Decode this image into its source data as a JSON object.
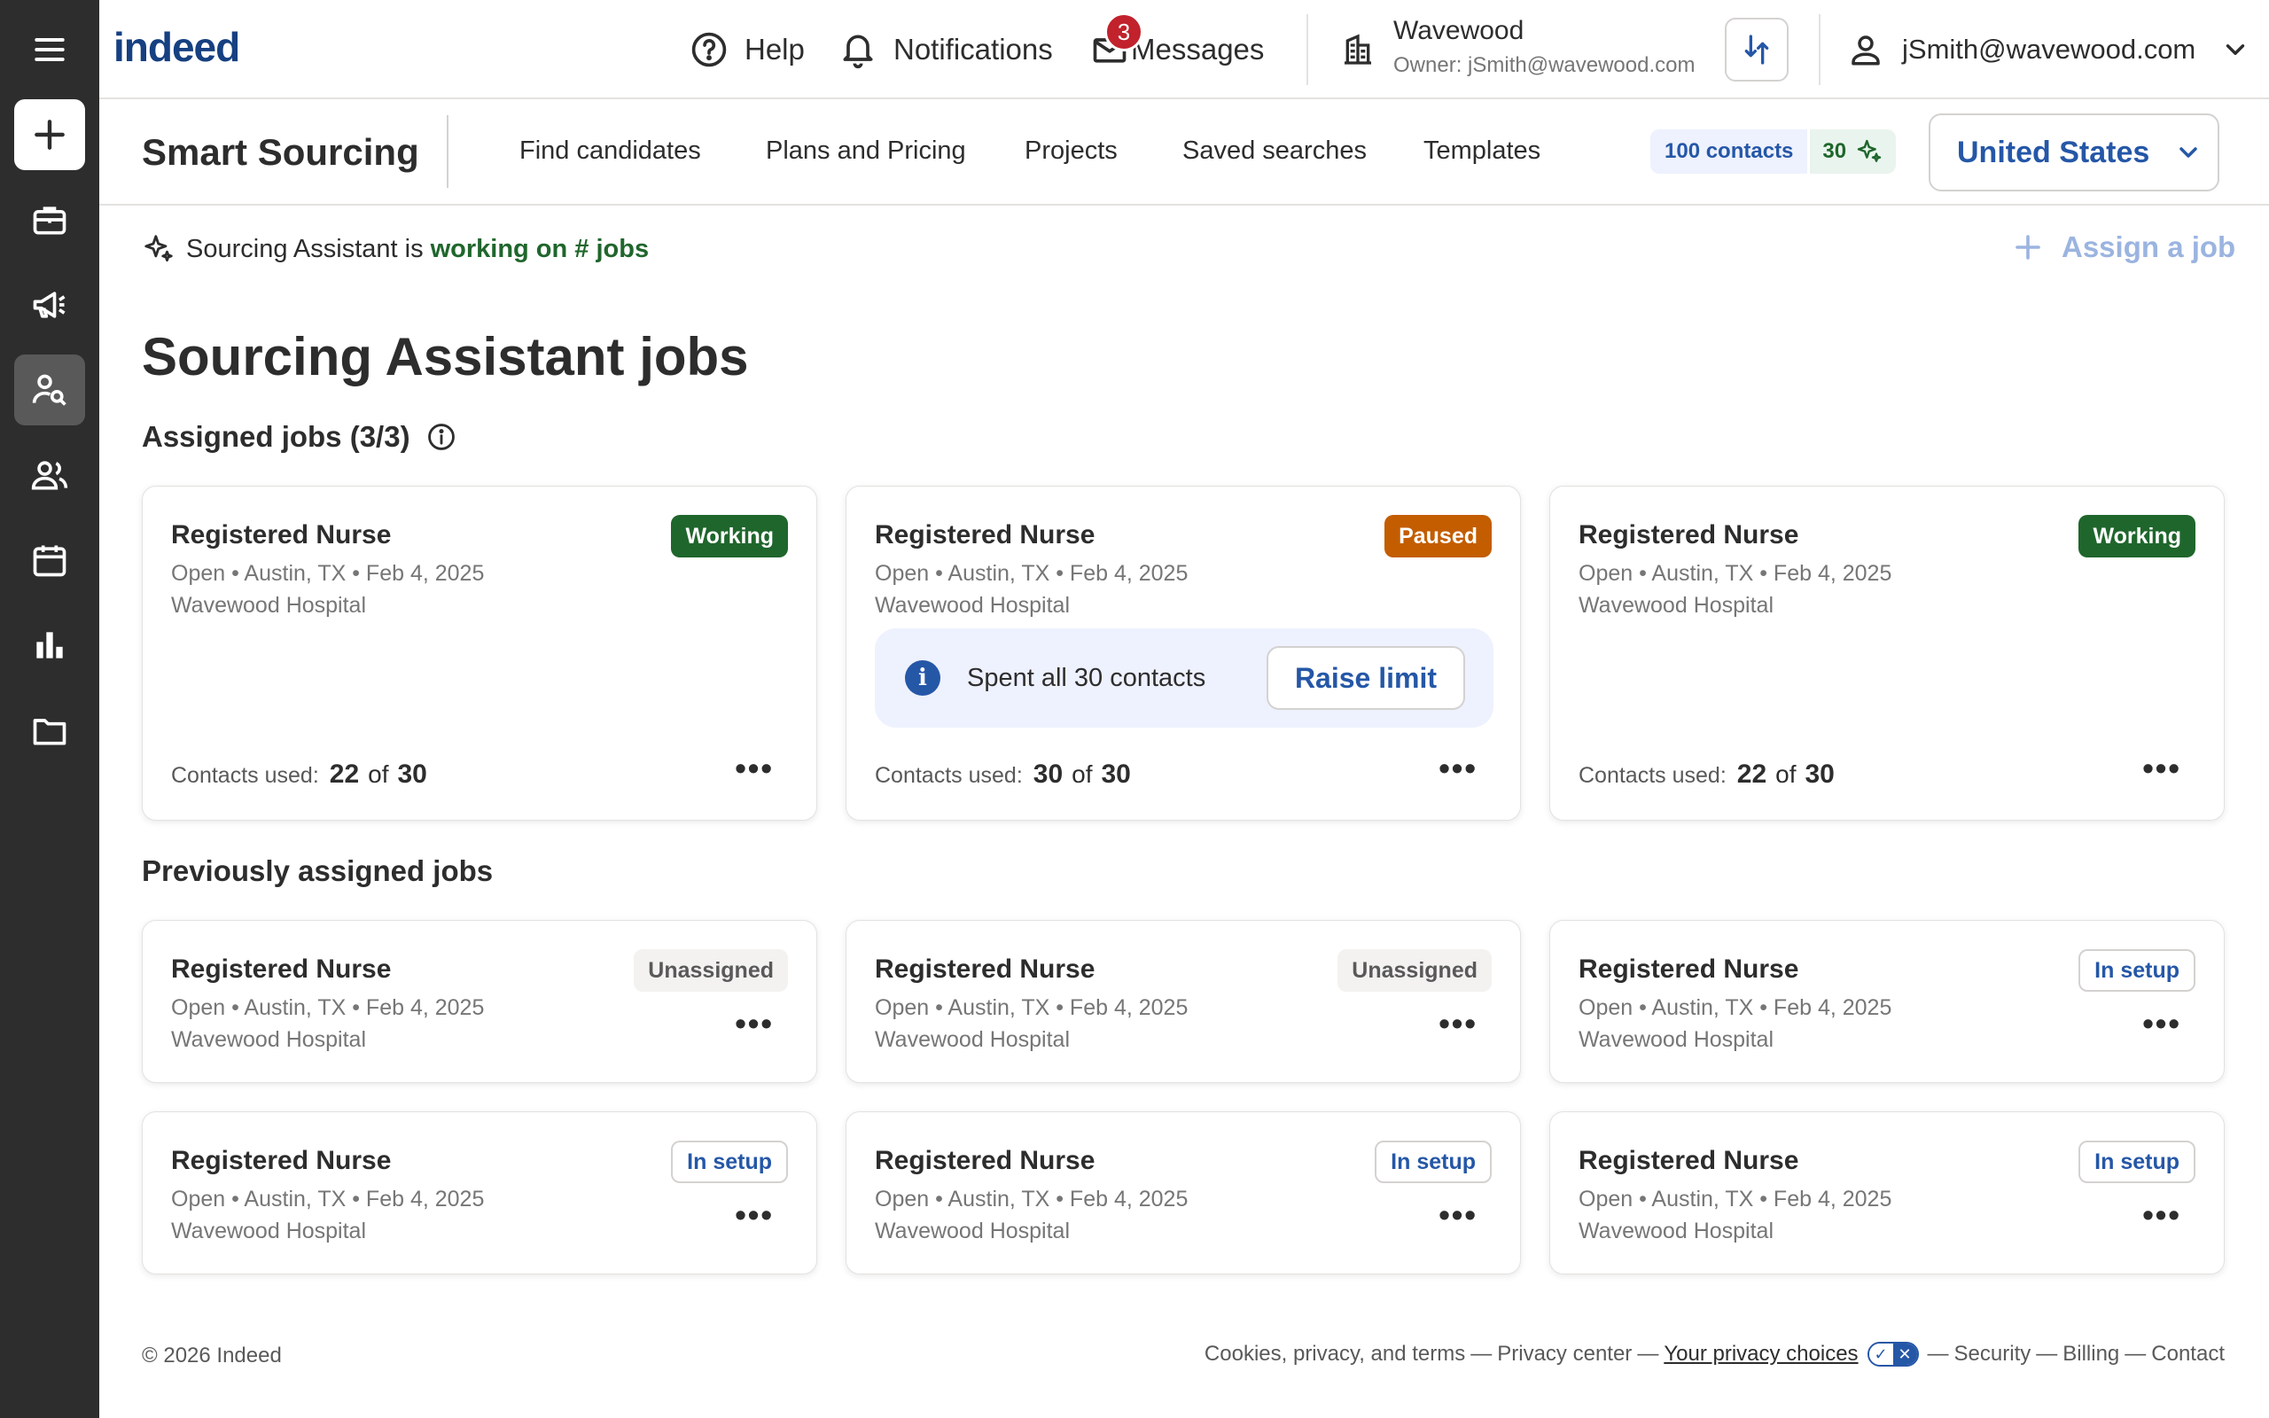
{
  "header": {
    "logo": "indeed",
    "help": "Help",
    "notifications": "Notifications",
    "messages": "Messages",
    "messages_count": "3",
    "company_name": "Wavewood",
    "company_owner": "Owner: jSmith@wavewood.com",
    "account_email": "jSmith@wavewood.com"
  },
  "subnav": {
    "product": "Smart Sourcing",
    "links": [
      "Find candidates",
      "Plans and Pricing",
      "Projects",
      "Saved searches",
      "Templates"
    ],
    "contacts_credit": "100 contacts",
    "ai_credit": "30",
    "country": "United States"
  },
  "assistant": {
    "prefix": "Sourcing Assistant is",
    "status": "working on # jobs",
    "assign_label": "Assign a job"
  },
  "page_title": "Sourcing Assistant jobs",
  "assigned": {
    "title": "Assigned jobs (3/3)",
    "jobs": [
      {
        "title": "Registered Nurse",
        "meta": "Open • Austin, TX • Feb 4, 2025",
        "org": "Wavewood Hospital",
        "status": "Working",
        "used_label": "Contacts used:",
        "used": "22",
        "of": "of",
        "total": "30"
      },
      {
        "title": "Registered Nurse",
        "meta": "Open • Austin, TX • Feb 4, 2025",
        "org": "Wavewood Hospital",
        "status": "Paused",
        "used_label": "Contacts used:",
        "used": "30",
        "of": "of",
        "total": "30",
        "limit_text": "Spent all 30 contacts",
        "raise_label": "Raise limit"
      },
      {
        "title": "Registered Nurse",
        "meta": "Open • Austin, TX • Feb 4, 2025",
        "org": "Wavewood Hospital",
        "status": "Working",
        "used_label": "Contacts used:",
        "used": "22",
        "of": "of",
        "total": "30"
      }
    ]
  },
  "previous": {
    "title": "Previously assigned jobs",
    "jobs": [
      {
        "title": "Registered Nurse",
        "meta": "Open • Austin, TX • Feb 4, 2025",
        "org": "Wavewood Hospital",
        "status": "Unassigned"
      },
      {
        "title": "Registered Nurse",
        "meta": "Open • Austin, TX • Feb 4, 2025",
        "org": "Wavewood Hospital",
        "status": "Unassigned"
      },
      {
        "title": "Registered Nurse",
        "meta": "Open • Austin, TX • Feb 4, 2025",
        "org": "Wavewood Hospital",
        "status": "In setup"
      },
      {
        "title": "Registered Nurse",
        "meta": "Open • Austin, TX • Feb 4, 2025",
        "org": "Wavewood Hospital",
        "status": "In setup"
      },
      {
        "title": "Registered Nurse",
        "meta": "Open • Austin, TX • Feb 4, 2025",
        "org": "Wavewood Hospital",
        "status": "In setup"
      },
      {
        "title": "Registered Nurse",
        "meta": "Open • Austin, TX • Feb 4, 2025",
        "org": "Wavewood Hospital",
        "status": "In setup"
      }
    ]
  },
  "footer": {
    "copyright": "© 2026 Indeed",
    "links": [
      "Cookies, privacy, and terms",
      "Privacy center",
      "Your privacy choices",
      "Security",
      "Billing",
      "Contact"
    ],
    "separator": "—"
  },
  "colors": {
    "brand_blue": "#2557a7",
    "logo_blue": "#164081",
    "working_green": "#1f662c",
    "paused_orange": "#c35d00",
    "rail_dark": "#2d2d2d",
    "badge_red": "#c1222c"
  },
  "icons": {
    "rail": [
      "menu-icon",
      "plus-icon",
      "briefcase-icon",
      "megaphone-icon",
      "person-search-icon",
      "people-icon",
      "calendar-icon",
      "bar-chart-icon",
      "folder-icon"
    ],
    "header": [
      "help-icon",
      "bell-icon",
      "mail-icon",
      "building-icon",
      "switch-arrows-icon",
      "user-icon",
      "chevron-down-icon"
    ]
  }
}
